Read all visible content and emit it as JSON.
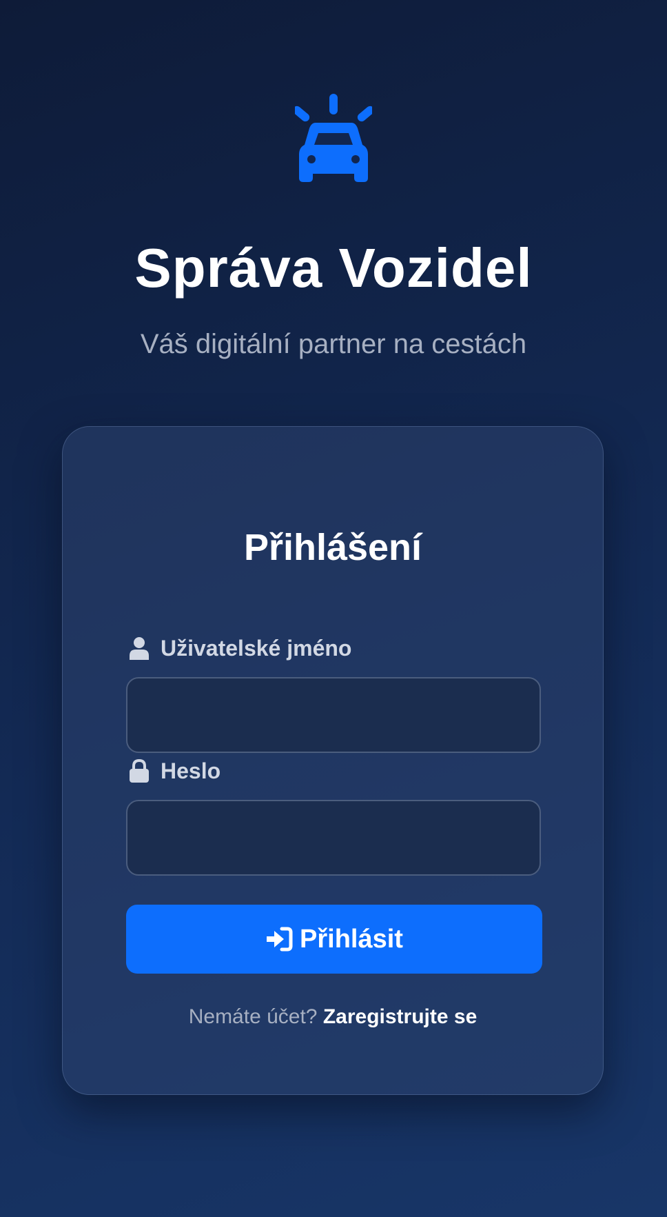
{
  "brand": {
    "icon": "car-siren-icon",
    "icon_color": "#0d6efd",
    "title": "Správa Vozidel",
    "subtitle": "Váš digitální partner na cestách"
  },
  "login_form": {
    "title": "Přihlášení",
    "username": {
      "label": "Uživatelské jméno",
      "icon": "user-icon",
      "value": "",
      "placeholder": ""
    },
    "password": {
      "label": "Heslo",
      "icon": "lock-icon",
      "value": "",
      "placeholder": ""
    },
    "submit": {
      "label": "Přihlásit",
      "icon": "sign-in-icon",
      "color": "#0d6efd"
    },
    "register": {
      "prompt": "Nemáte účet?",
      "link": "Zaregistrujte se"
    }
  }
}
